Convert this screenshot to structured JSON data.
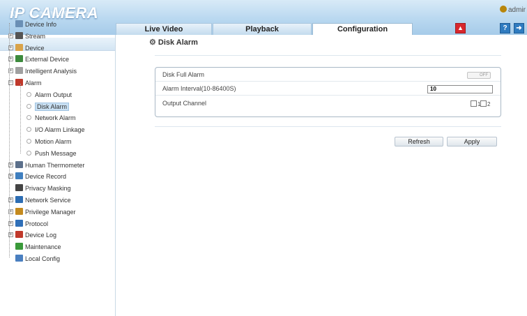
{
  "header": {
    "logo": "IP CAMERA",
    "user": "admir"
  },
  "tabs": [
    {
      "label": "Live Video",
      "active": false
    },
    {
      "label": "Playback",
      "active": false
    },
    {
      "label": "Configuration",
      "active": true
    }
  ],
  "header_buttons": {
    "alarm_icon": "alarm-bell-icon",
    "help_icon": "help-icon",
    "logout_icon": "logout-icon"
  },
  "nav": [
    {
      "label": "Device Info",
      "icon": "device-info-icon",
      "expandable": false
    },
    {
      "label": "Stream",
      "icon": "stream-icon",
      "expandable": true
    },
    {
      "label": "Device",
      "icon": "device-icon",
      "expandable": true
    },
    {
      "label": "External Device",
      "icon": "external-device-icon",
      "expandable": true
    },
    {
      "label": "Intelligent Analysis",
      "icon": "intelligent-analysis-icon",
      "expandable": true
    },
    {
      "label": "Alarm",
      "icon": "alarm-icon",
      "expandable": true,
      "expanded": true
    },
    {
      "label": "Alarm Output",
      "child": true
    },
    {
      "label": "Disk Alarm",
      "child": true,
      "selected": true
    },
    {
      "label": "Network Alarm",
      "child": true
    },
    {
      "label": "I/O Alarm Linkage",
      "child": true
    },
    {
      "label": "Motion Alarm",
      "child": true
    },
    {
      "label": "Push Message",
      "child": true
    },
    {
      "label": "Human Thermometer",
      "icon": "thermometer-icon",
      "expandable": true
    },
    {
      "label": "Device Record",
      "icon": "device-record-icon",
      "expandable": true
    },
    {
      "label": "Privacy Masking",
      "icon": "privacy-masking-icon",
      "expandable": false
    },
    {
      "label": "Network Service",
      "icon": "network-service-icon",
      "expandable": true
    },
    {
      "label": "Privilege Manager",
      "icon": "privilege-manager-icon",
      "expandable": true
    },
    {
      "label": "Protocol",
      "icon": "protocol-icon",
      "expandable": true
    },
    {
      "label": "Device Log",
      "icon": "device-log-icon",
      "expandable": true
    },
    {
      "label": "Maintenance",
      "icon": "maintenance-icon",
      "expandable": false
    },
    {
      "label": "Local Config",
      "icon": "local-config-icon",
      "expandable": false
    }
  ],
  "main": {
    "title": "Disk Alarm",
    "disk_full_alarm": {
      "label": "Disk Full Alarm",
      "switch_text": "OFF",
      "state": "off"
    },
    "alarm_interval": {
      "label": "Alarm Interval(10-86400S)",
      "value": "10"
    },
    "output_channel": {
      "label": "Output Channel",
      "options": [
        "1",
        "2"
      ]
    },
    "refresh_label": "Refresh",
    "apply_label": "Apply"
  },
  "colors": {
    "header": "#b9d8f0",
    "alarm_button": "#d8272d",
    "selection": "#c9e0f3"
  }
}
